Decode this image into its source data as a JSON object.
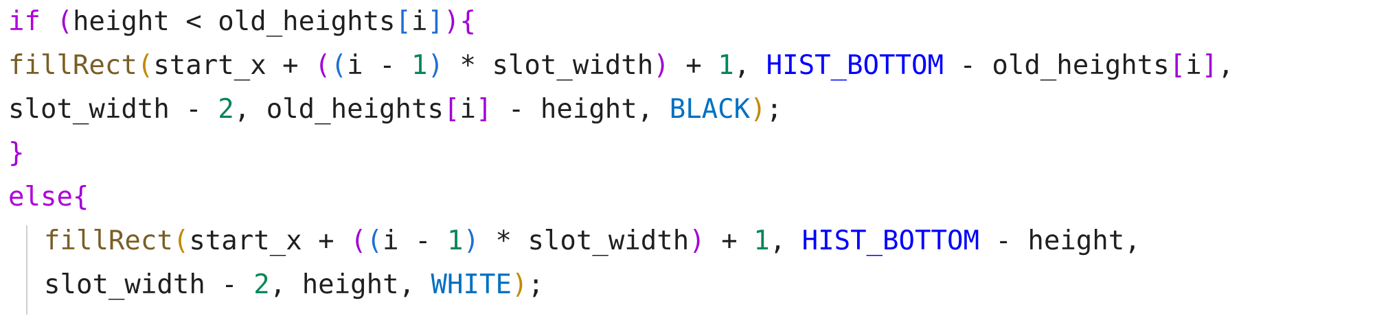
{
  "colors": {
    "default": "#1f1f1f",
    "keyword": "#af00db",
    "function": "#795e26",
    "number": "#098658",
    "macro": "#0000ff",
    "color_const": "#0070c1",
    "paren_gold": "#c08a00",
    "paren_purple": "#a100d6",
    "paren_blue": "#1f6fd1",
    "indent_guide": "#cfcfcf"
  },
  "code": {
    "lines": [
      {
        "id": "line-1",
        "indent": 0,
        "tokens": [
          {
            "t": "if",
            "c": "keyword"
          },
          {
            "t": " ",
            "c": "default"
          },
          {
            "t": "(",
            "c": "paren_purple"
          },
          {
            "t": "height < old_heights",
            "c": "default"
          },
          {
            "t": "[",
            "c": "paren_blue"
          },
          {
            "t": "i",
            "c": "default"
          },
          {
            "t": "]",
            "c": "paren_blue"
          },
          {
            "t": ")",
            "c": "paren_purple"
          },
          {
            "t": "{",
            "c": "paren_purple"
          }
        ]
      },
      {
        "id": "line-2",
        "indent": 0,
        "tokens": [
          {
            "t": "fillRect",
            "c": "function"
          },
          {
            "t": "(",
            "c": "paren_gold"
          },
          {
            "t": "start_x + ",
            "c": "default"
          },
          {
            "t": "(",
            "c": "paren_purple"
          },
          {
            "t": "(",
            "c": "paren_blue"
          },
          {
            "t": "i - ",
            "c": "default"
          },
          {
            "t": "1",
            "c": "number"
          },
          {
            "t": ")",
            "c": "paren_blue"
          },
          {
            "t": " * slot_width",
            "c": "default"
          },
          {
            "t": ")",
            "c": "paren_purple"
          },
          {
            "t": " + ",
            "c": "default"
          },
          {
            "t": "1",
            "c": "number"
          },
          {
            "t": ", ",
            "c": "default"
          },
          {
            "t": "HIST_BOTTOM",
            "c": "macro"
          },
          {
            "t": " - old_heights",
            "c": "default"
          },
          {
            "t": "[",
            "c": "paren_purple"
          },
          {
            "t": "i",
            "c": "default"
          },
          {
            "t": "]",
            "c": "paren_purple"
          },
          {
            "t": ",",
            "c": "default"
          }
        ]
      },
      {
        "id": "line-3",
        "indent": 0,
        "tokens": [
          {
            "t": "slot_width - ",
            "c": "default"
          },
          {
            "t": "2",
            "c": "number"
          },
          {
            "t": ", old_heights",
            "c": "default"
          },
          {
            "t": "[",
            "c": "paren_purple"
          },
          {
            "t": "i",
            "c": "default"
          },
          {
            "t": "]",
            "c": "paren_purple"
          },
          {
            "t": " - height, ",
            "c": "default"
          },
          {
            "t": "BLACK",
            "c": "color_const"
          },
          {
            "t": ")",
            "c": "paren_gold"
          },
          {
            "t": ";",
            "c": "default"
          }
        ]
      },
      {
        "id": "line-4",
        "indent": 0,
        "tokens": [
          {
            "t": "}",
            "c": "paren_purple"
          }
        ]
      },
      {
        "id": "line-5",
        "indent": 0,
        "tokens": [
          {
            "t": "else",
            "c": "keyword"
          },
          {
            "t": "{",
            "c": "paren_purple"
          }
        ]
      },
      {
        "id": "line-6",
        "indent": 1,
        "tokens": [
          {
            "t": "fillRect",
            "c": "function"
          },
          {
            "t": "(",
            "c": "paren_gold"
          },
          {
            "t": "start_x + ",
            "c": "default"
          },
          {
            "t": "(",
            "c": "paren_purple"
          },
          {
            "t": "(",
            "c": "paren_blue"
          },
          {
            "t": "i - ",
            "c": "default"
          },
          {
            "t": "1",
            "c": "number"
          },
          {
            "t": ")",
            "c": "paren_blue"
          },
          {
            "t": " * slot_width",
            "c": "default"
          },
          {
            "t": ")",
            "c": "paren_purple"
          },
          {
            "t": " + ",
            "c": "default"
          },
          {
            "t": "1",
            "c": "number"
          },
          {
            "t": ", ",
            "c": "default"
          },
          {
            "t": "HIST_BOTTOM",
            "c": "macro"
          },
          {
            "t": " - height,",
            "c": "default"
          }
        ]
      },
      {
        "id": "line-7",
        "indent": 1,
        "tokens": [
          {
            "t": "slot_width - ",
            "c": "default"
          },
          {
            "t": "2",
            "c": "number"
          },
          {
            "t": ", height, ",
            "c": "default"
          },
          {
            "t": "WHITE",
            "c": "color_const"
          },
          {
            "t": ")",
            "c": "paren_gold"
          },
          {
            "t": ";",
            "c": "default"
          }
        ]
      }
    ]
  }
}
